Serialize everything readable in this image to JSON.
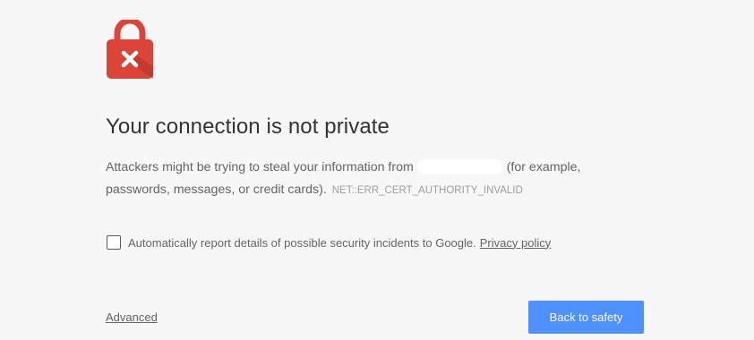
{
  "title": "Your connection is not private",
  "body": {
    "text_before": "Attackers might be trying to steal your information from",
    "text_after": "(for example, passwords, messages, or credit cards).",
    "error_code": "NET::ERR_CERT_AUTHORITY_INVALID"
  },
  "report": {
    "label": "Automatically report details of possible security incidents to Google.",
    "privacy_link": "Privacy policy",
    "checked": false
  },
  "advanced_link": "Advanced",
  "back_button": "Back to safety",
  "colors": {
    "background": "#f7f7f7",
    "lock_red": "#db4437",
    "button_blue": "#4d90fe"
  },
  "icons": {
    "lock": "lock-error-icon"
  }
}
